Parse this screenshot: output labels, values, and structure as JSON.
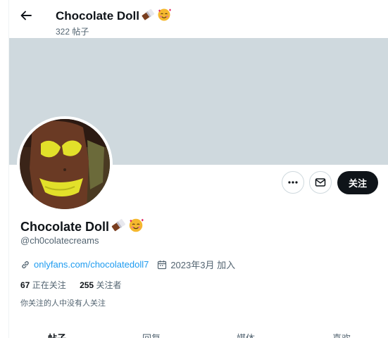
{
  "header": {
    "display_name": "Chocolate Doll",
    "post_count": "322 帖子"
  },
  "icons": {
    "back": "arrow-left-icon",
    "more": "more-horizontal-icon",
    "message": "mail-icon",
    "link": "link-icon",
    "calendar": "calendar-icon",
    "name_emojis": [
      "chocolate-bar-emoji",
      "smiling-face-with-hearts-emoji"
    ]
  },
  "actions": {
    "follow_label": "关注"
  },
  "profile": {
    "display_name": "Chocolate Doll",
    "handle": "@ch0colatecreams",
    "website": "onlyfans.com/chocolatedoll7",
    "joined": "2023年3月 加入",
    "following_count": "67",
    "following_label": "正在关注",
    "followers_count": "255",
    "followers_label": "关注者",
    "followers_you_know": "你关注的人中没有人关注"
  },
  "tabs": [
    {
      "label": "帖子",
      "active": true
    },
    {
      "label": "回复",
      "active": false
    },
    {
      "label": "媒体",
      "active": false
    },
    {
      "label": "喜欢",
      "active": false
    }
  ],
  "colors": {
    "banner": "#cfd9de",
    "link": "#1d9bf0",
    "follow_button": "#0f1419",
    "secondary_text": "#536471"
  }
}
